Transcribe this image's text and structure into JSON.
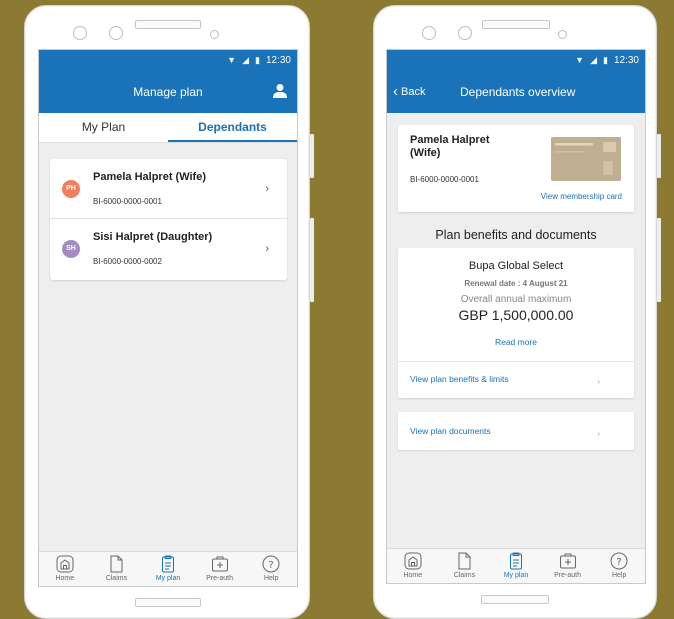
{
  "status_bar": {
    "time": "12:30"
  },
  "left_screen": {
    "title": "Manage plan",
    "tabs": [
      {
        "label": "My Plan",
        "active": false
      },
      {
        "label": "Dependants",
        "active": true
      }
    ],
    "dependants": [
      {
        "initials": "PH",
        "name": "Pamela Halpret (Wife)",
        "id": "BI-6000-0000-0001",
        "avatar_color": "#f07f5e"
      },
      {
        "initials": "SH",
        "name": "Sisi Halpret (Daughter)",
        "id": "BI-6000-0000-0002",
        "avatar_color": "#a58bc4"
      }
    ]
  },
  "right_screen": {
    "back_label": "Back",
    "title": "Dependants overview",
    "member": {
      "name": "Pamela Halpret (Wife)",
      "id": "BI-6000-0000-0001",
      "card_link": "View membership card"
    },
    "section_title": "Plan benefits and documents",
    "plan": {
      "name": "Bupa Global Select",
      "renewal": "Renewal date : 4 August 21",
      "max_label": "Overall annual maximum",
      "max_amount": "GBP 1,500,000.00",
      "read_more": "Read more",
      "benefits_link": "View plan benefits & limits"
    },
    "documents_link": "View plan documents"
  },
  "bottom_nav": [
    {
      "label": "Home",
      "icon": "home-icon"
    },
    {
      "label": "Claims",
      "icon": "document-icon"
    },
    {
      "label": "My plan",
      "icon": "clipboard-icon",
      "active": true
    },
    {
      "label": "Pre-auth",
      "icon": "medical-bag-icon"
    },
    {
      "label": "Help",
      "icon": "help-icon"
    }
  ],
  "colors": {
    "primary": "#1a73b8",
    "background": "#8c7a32"
  }
}
